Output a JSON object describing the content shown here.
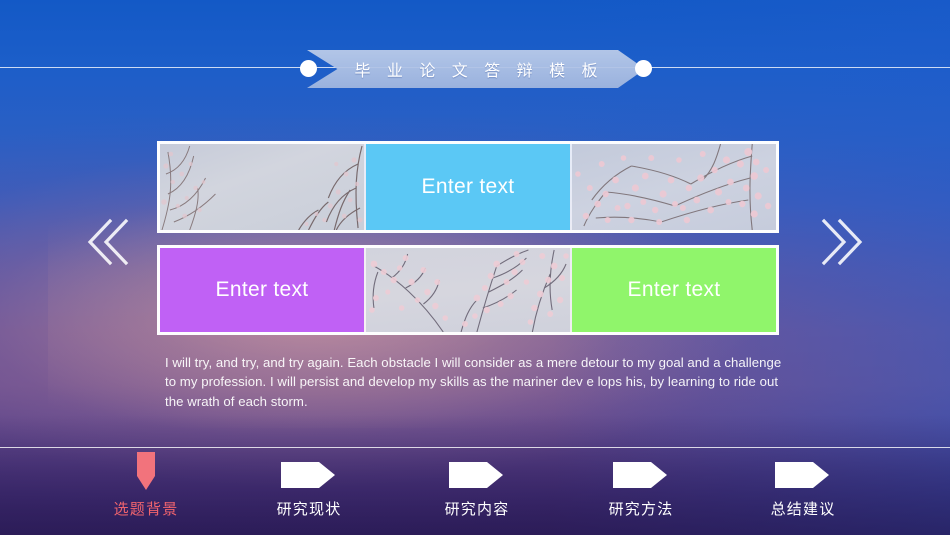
{
  "slide": {
    "title": "毕 业 论 文 答 辩 模 板",
    "title_plain": "毕业论文答辩模板"
  },
  "colors": {
    "accent_blue": "#5bc8f5",
    "accent_purple": "#c061f5",
    "accent_green": "#90f56b",
    "active_nav": "#f0646e",
    "banner_fill": "#b9c9e6",
    "bg_top": "#1359c6",
    "bg_bottom": "#352366"
  },
  "side_nav": {
    "prev_icon": "chevron-double-left-icon",
    "next_icon": "chevron-double-right-icon"
  },
  "grid": {
    "rows": [
      {
        "cells": [
          {
            "type": "photo",
            "variant": "A",
            "label": ""
          },
          {
            "type": "color",
            "color": "#5bc8f5",
            "label": "Enter text"
          },
          {
            "type": "photo",
            "variant": "C",
            "label": ""
          }
        ]
      },
      {
        "cells": [
          {
            "type": "color",
            "color": "#c061f5",
            "label": "Enter text"
          },
          {
            "type": "photo",
            "variant": "B",
            "label": ""
          },
          {
            "type": "color",
            "color": "#90f56b",
            "label": "Enter text"
          }
        ]
      }
    ]
  },
  "body": {
    "paragraph": "I will try, and try, and try again. Each obstacle I will consider as a mere detour to my goal and a challenge to my profession. I will persist and develop my skills as the mariner dev e lops his, by learning to ride out the wrath of each storm."
  },
  "bottom_nav": {
    "items": [
      {
        "label": "选题背景",
        "icon": "arrow-down-icon",
        "active": true
      },
      {
        "label": "研究现状",
        "icon": "arrow-right-icon",
        "active": false
      },
      {
        "label": "研究内容",
        "icon": "arrow-right-icon",
        "active": false
      },
      {
        "label": "研究方法",
        "icon": "arrow-right-icon",
        "active": false
      },
      {
        "label": "总结建议",
        "icon": "arrow-right-icon",
        "active": false
      }
    ]
  }
}
